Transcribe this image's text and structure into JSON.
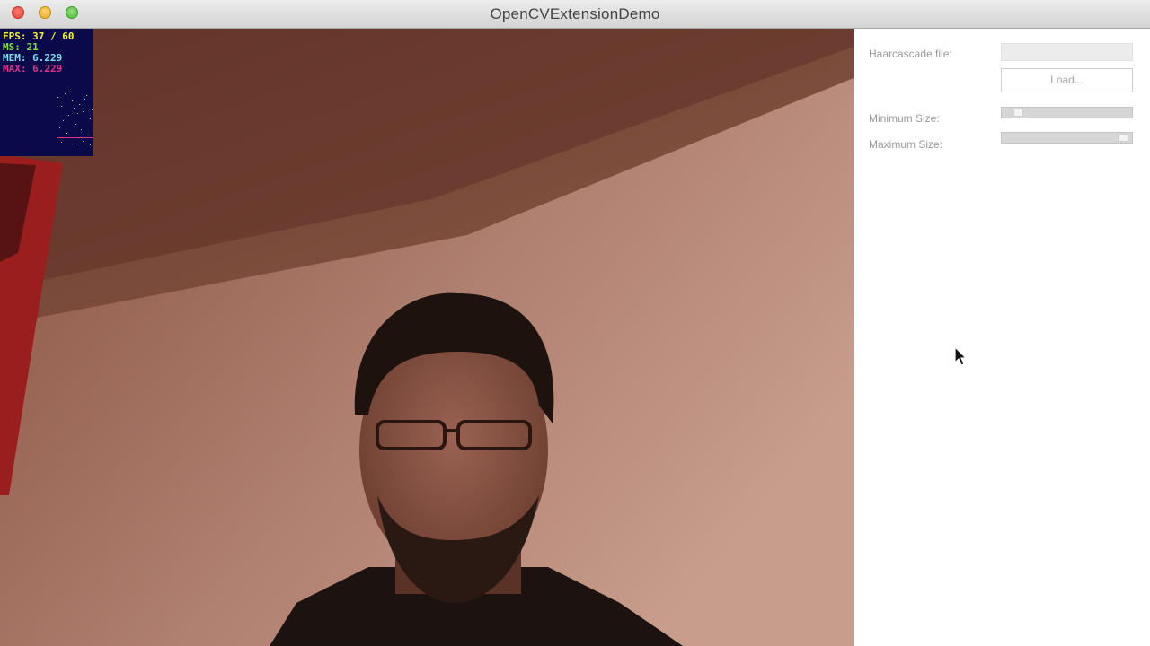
{
  "window": {
    "title": "OpenCVExtensionDemo"
  },
  "perf_monitor": {
    "fps": "FPS: 37 / 60",
    "ms": "MS: 21",
    "mem": "MEM: 6.229",
    "max": "MAX: 6.229"
  },
  "panel": {
    "haarcascade_label": "Haarcascade file:",
    "haarcascade_value": "",
    "load_button": "Load...",
    "min_size_label": "Minimum Size:",
    "min_size_level": 0.1,
    "max_size_label": "Maximum Size:",
    "max_size_level": 0.97
  },
  "colors": {
    "panel_bg": "#ffffff",
    "perf_bg": "#0a0a4a",
    "fps": "#f2f23a",
    "ms": "#7fe040",
    "mem": "#7fe0f0",
    "max": "#e0308a"
  },
  "icons": {
    "close": "close-traffic-light",
    "minimize": "minimize-traffic-light",
    "zoom": "zoom-traffic-light",
    "cursor": "mouse-pointer-icon"
  }
}
